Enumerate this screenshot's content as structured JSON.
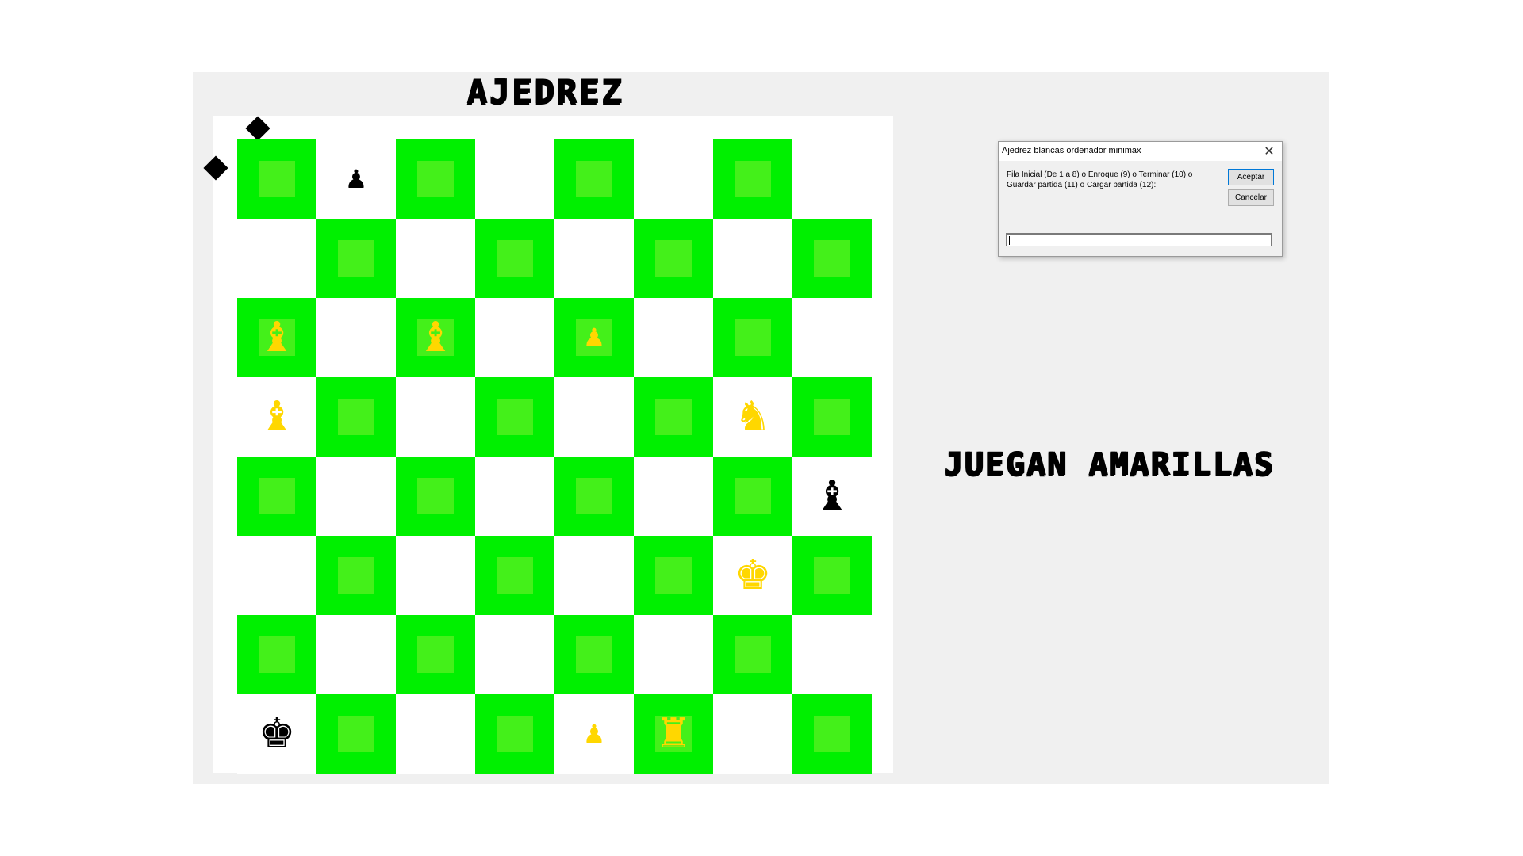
{
  "window": {
    "title": "AJEDREZ",
    "turn_text": "JUEGAN AMARILLAS"
  },
  "colors": {
    "board_green": "#00f000",
    "board_white": "#ffffff",
    "yellow_pieces": "#ffd700",
    "black_pieces": "#000000"
  },
  "dialog": {
    "title": "Ajedrez blancas ordenador minimax",
    "prompt": "Fila Inicial (De 1 a 8) o Enroque (9) o Terminar (10) o Guardar partida (11) o Cargar partida (12):",
    "accept_label": "Aceptar",
    "cancel_label": "Cancelar",
    "input_value": ""
  },
  "board": {
    "rows": 8,
    "cols": 8,
    "pieces": [
      {
        "row": 0,
        "col": 1,
        "type": "pawn",
        "color": "black",
        "glyph": "♟",
        "size": "small"
      },
      {
        "row": 2,
        "col": 0,
        "type": "bishop",
        "color": "yellow",
        "glyph": "♝",
        "size": "big"
      },
      {
        "row": 2,
        "col": 2,
        "type": "bishop",
        "color": "yellow",
        "glyph": "♝",
        "size": "big"
      },
      {
        "row": 2,
        "col": 4,
        "type": "pawn",
        "color": "yellow",
        "glyph": "♟",
        "size": "small"
      },
      {
        "row": 3,
        "col": 0,
        "type": "bishop",
        "color": "yellow",
        "glyph": "♝",
        "size": "big"
      },
      {
        "row": 3,
        "col": 6,
        "type": "knight",
        "color": "yellow",
        "glyph": "♞",
        "size": "big"
      },
      {
        "row": 4,
        "col": 7,
        "type": "bishop",
        "color": "black",
        "glyph": "♝",
        "size": "big"
      },
      {
        "row": 5,
        "col": 6,
        "type": "king",
        "color": "yellow",
        "glyph": "♚",
        "size": "big"
      },
      {
        "row": 7,
        "col": 0,
        "type": "king",
        "color": "black",
        "glyph": "♚",
        "size": "big"
      },
      {
        "row": 7,
        "col": 4,
        "type": "pawn",
        "color": "yellow",
        "glyph": "♟",
        "size": "small"
      },
      {
        "row": 7,
        "col": 5,
        "type": "rook",
        "color": "yellow",
        "glyph": "♜",
        "size": "big"
      }
    ]
  }
}
